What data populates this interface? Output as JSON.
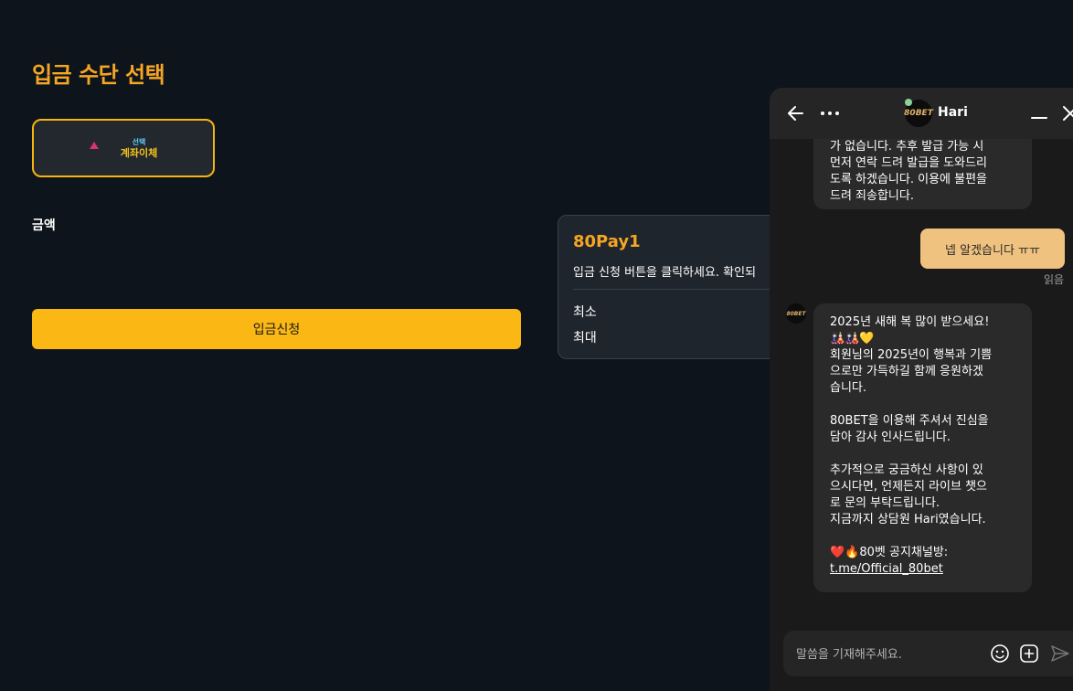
{
  "page": {
    "title": "입금 수단 선택",
    "method": {
      "small_label": "선택",
      "label": "계좌이체"
    },
    "amount_label": "금액",
    "submit_label": "입금신청"
  },
  "pay_info": {
    "title": "80Pay1",
    "description": "입금 신청 버튼을 클릭하세요. 확인되",
    "min_label": "최소",
    "max_label": "최대"
  },
  "chat": {
    "agent_name": "Hari",
    "avatar_text": "80BET",
    "messages": [
      {
        "from": "agent",
        "text": "가 없습니다. 추후 발급 가능 시\n먼저 연락 드려 발급을 도와드리\n도록 하겠습니다. 이용에 불편을\n드려 죄송합니다."
      },
      {
        "from": "user",
        "text": "넵 알겠습니다 ㅠㅠ",
        "status": "읽음"
      },
      {
        "from": "agent",
        "para1": "2025년 새해 복 많이 받으세요!\n🎎🎎💛\n회원님의 2025년이 행복과 기쁨\n으로만 가득하길 함께 응원하겠\n습니다.",
        "para2": "80BET을 이용해 주셔서 진심을\n담아 감사 인사드립니다.",
        "para3": "추가적으로 궁금하신 사항이 있\n으시다면, 언제든지 라이브 챗으\n로 문의 부탁드립니다.\n지금까지 상담원 Hari였습니다.",
        "para4": "❤️🔥80벳 공지채널방:",
        "link": "t.me/Official_80bet"
      }
    ],
    "input_placeholder": "말씀을 기재해주세요."
  },
  "colors": {
    "accent": "#f5a623",
    "button": "#fbb714",
    "user_bubble": "#f0c27f"
  }
}
